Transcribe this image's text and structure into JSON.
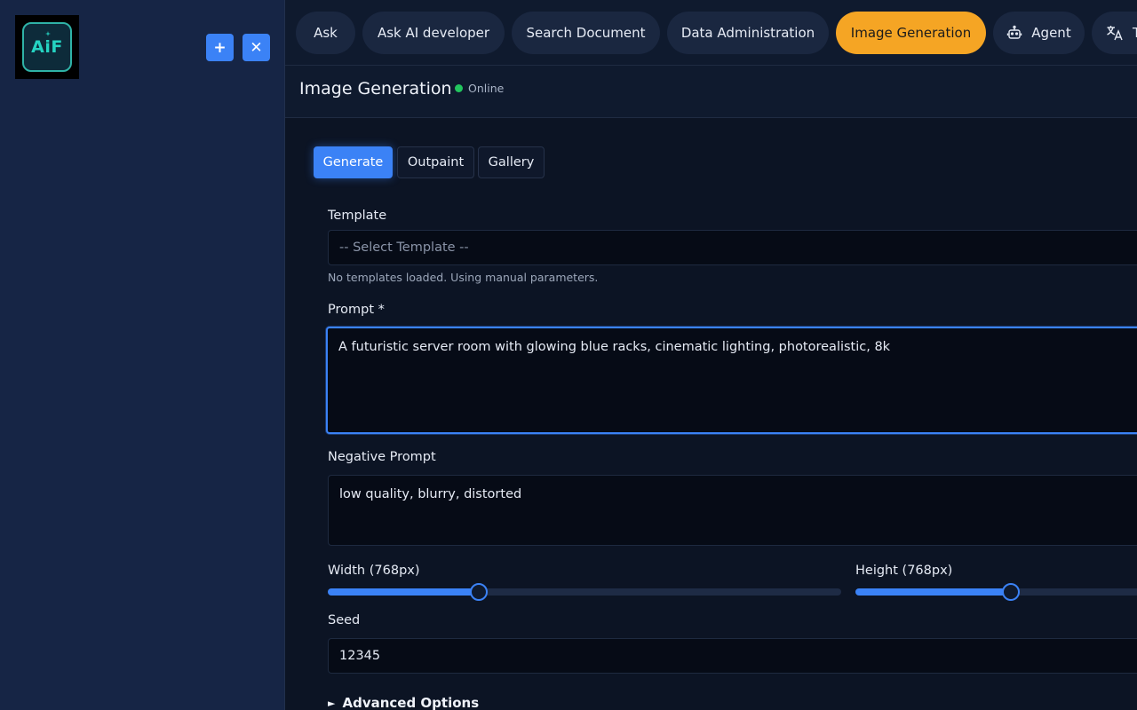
{
  "app": {
    "logo_text": "AiF"
  },
  "nav": {
    "items": [
      {
        "label": "Ask",
        "active": false
      },
      {
        "label": "Ask AI developer",
        "active": false
      },
      {
        "label": "Search Document",
        "active": false
      },
      {
        "label": "Data Administration",
        "active": false
      },
      {
        "label": "Image Generation",
        "active": true
      },
      {
        "label": "Agent",
        "icon": "robot-icon",
        "active": false
      },
      {
        "label": "T",
        "icon": "translate-icon",
        "active": false
      }
    ]
  },
  "header": {
    "title": "Image Generation",
    "status": "Online"
  },
  "tabs": [
    {
      "label": "Generate",
      "active": true
    },
    {
      "label": "Outpaint",
      "active": false
    },
    {
      "label": "Gallery",
      "active": false
    }
  ],
  "form": {
    "template_label": "Template",
    "template_placeholder": "-- Select Template --",
    "template_hint": "No templates loaded. Using manual parameters.",
    "prompt_label": "Prompt *",
    "prompt_value": "A futuristic server room with glowing blue racks, cinematic lighting, photorealistic, 8k",
    "negative_label": "Negative Prompt",
    "negative_value": "low quality, blurry, distorted",
    "width_label": "Width (768px)",
    "width_fraction": 0.294,
    "height_label": "Height (768px)",
    "height_fraction": 0.53,
    "seed_label": "Seed",
    "seed_value": "12345",
    "advanced_label": "Advanced Options"
  },
  "colors": {
    "accent": "#3b82f6",
    "active_nav": "#f5a524",
    "online": "#22c55e"
  }
}
